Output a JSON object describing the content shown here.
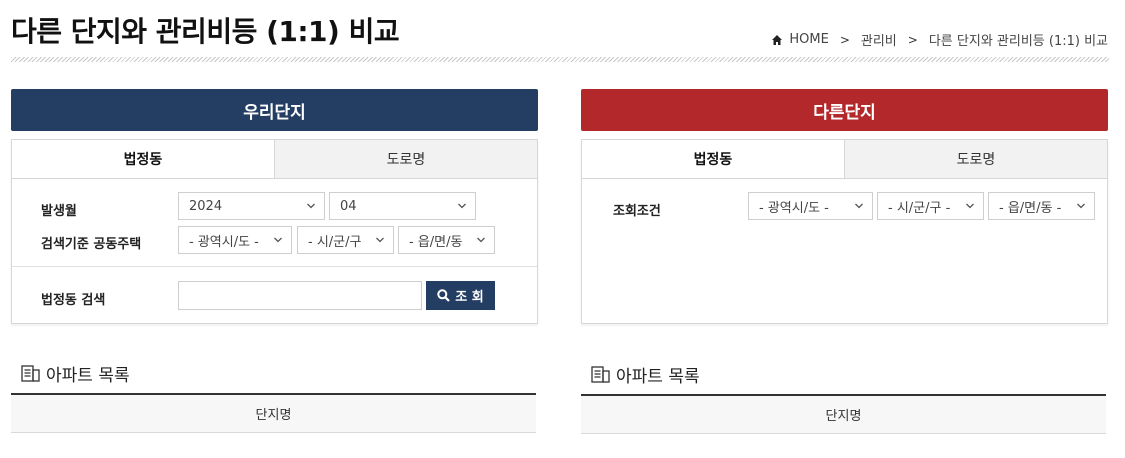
{
  "page": {
    "title": "다른 단지와 관리비등 (1:1) 비교"
  },
  "breadcrumb": {
    "home": "HOME",
    "items": [
      "관리비",
      "다른 단지와 관리비등 (1:1) 비교"
    ]
  },
  "colors": {
    "our_complex": "#243d63",
    "other_complex": "#b3292b"
  },
  "left": {
    "header": "우리단지",
    "tabs": [
      "법정동",
      "도로명"
    ],
    "active_tab": "법정동",
    "fields": {
      "issue_month_label": "발생월",
      "year_value": "2024",
      "month_value": "04",
      "housing_label": "검색기준 공동주택",
      "province_placeholder": "- 광역시/도 -",
      "city_placeholder": "- 시/군/구",
      "town_placeholder": "- 읍/면/동",
      "dong_search_label": "법정동 검색",
      "dong_search_value": "",
      "search_button": "조 회"
    },
    "list": {
      "title": "아파트 목록",
      "column": "단지명"
    }
  },
  "right": {
    "header": "다른단지",
    "tabs": [
      "법정동",
      "도로명"
    ],
    "active_tab": "법정동",
    "fields": {
      "condition_label": "조회조건",
      "province_placeholder": "- 광역시/도 -",
      "city_placeholder": "- 시/군/구 -",
      "town_placeholder": "- 읍/면/동 -"
    },
    "list": {
      "title": "아파트 목록",
      "column": "단지명"
    }
  },
  "icons": {
    "home": "home-icon",
    "breadcrumb_separator": "chevron-right-icon",
    "select": "chevron-down-icon",
    "search": "search-icon",
    "list": "list-document-icon"
  }
}
